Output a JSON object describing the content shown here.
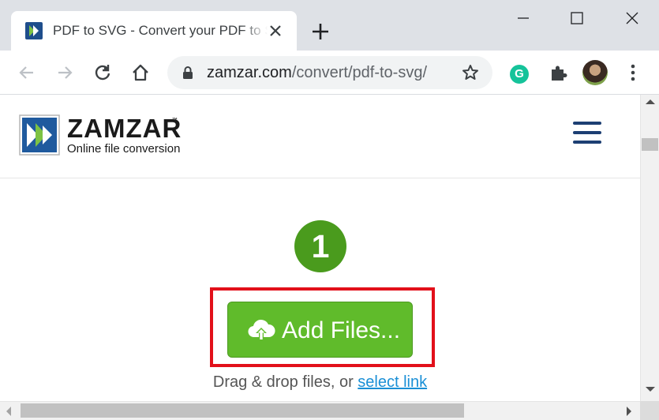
{
  "browser": {
    "tab_title": "PDF to SVG - Convert your PDF to SVG for Free Online",
    "url_host": "zamzar.com",
    "url_path": "/convert/pdf-to-svg/",
    "extension_letter": "G",
    "icons": {
      "back": "arrow-left-icon",
      "forward": "arrow-right-icon",
      "reload": "reload-icon",
      "home": "home-icon",
      "lock": "lock-icon",
      "bookmark": "star-icon",
      "extensions": "puzzle-icon",
      "menu": "kebab-menu-icon"
    }
  },
  "site": {
    "logo_name": "ZAMZAR",
    "logo_tm": "™",
    "tagline": "Online file conversion"
  },
  "converter": {
    "step_number": "1",
    "add_files_label": "Add Files...",
    "drop_text": "Drag & drop files, or ",
    "select_link": "select link"
  },
  "colors": {
    "brand_green": "#60bb2b",
    "step_green": "#4a9b1d",
    "highlight_red": "#e2101a",
    "nav_blue": "#1d3f73",
    "link_blue": "#1a8fd6"
  }
}
